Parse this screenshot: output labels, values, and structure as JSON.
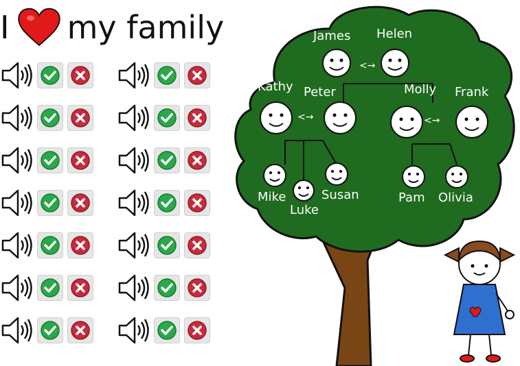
{
  "title": {
    "word1": "I",
    "word2": "my family",
    "heart_icon": "heart-icon"
  },
  "colors": {
    "leaf": "#1f6b1f",
    "trunk": "#7a4514",
    "check": "#2aa84a",
    "cross": "#c82b3c"
  },
  "rows": 7,
  "groups_per_row": 2,
  "controls": {
    "speaker_icon": "speaker-icon",
    "correct_icon": "checkmark-icon",
    "wrong_icon": "cross-icon"
  },
  "family": {
    "james": "James",
    "helen": "Helen",
    "kathy": "Kathy",
    "peter": "Peter",
    "molly": "Molly",
    "frank": "Frank",
    "mike": "Mike",
    "luke": "Luke",
    "susan": "Susan",
    "pam": "Pam",
    "olivia": "Olivia"
  }
}
